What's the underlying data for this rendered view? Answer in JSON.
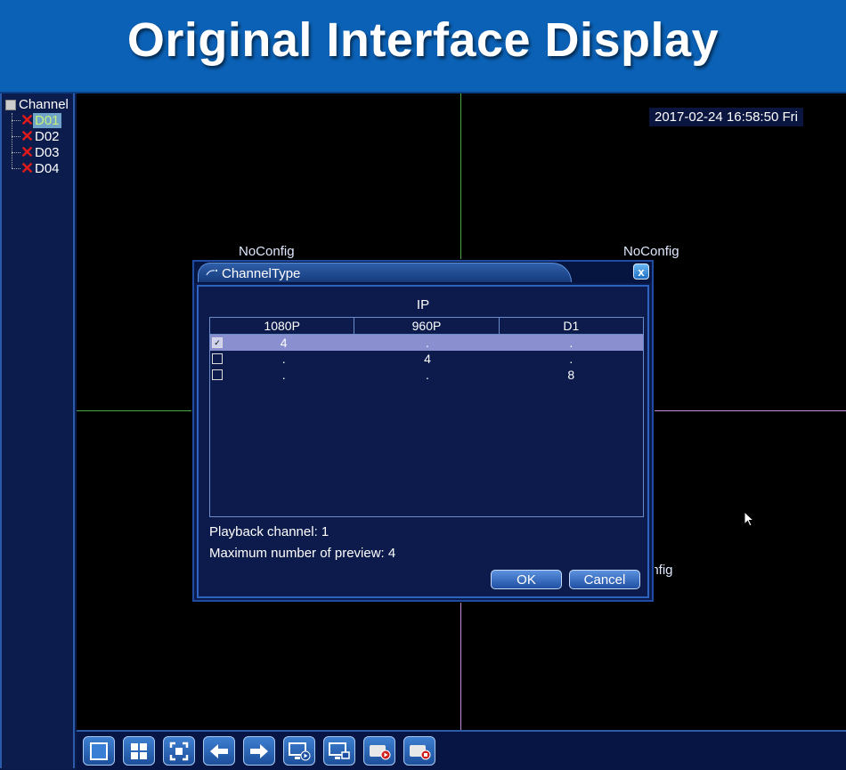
{
  "banner": {
    "title": "Original Interface Display"
  },
  "sidebar": {
    "root_label": "Channel",
    "items": [
      {
        "label": "D01",
        "selected": true
      },
      {
        "label": "D02",
        "selected": false
      },
      {
        "label": "D03",
        "selected": false
      },
      {
        "label": "D04",
        "selected": false
      }
    ]
  },
  "video": {
    "timestamp": "2017-02-24 16:58:50 Fri",
    "cells": [
      {
        "label": "NoConfig"
      },
      {
        "label": "NoConfig"
      },
      {
        "label": "onfig"
      }
    ]
  },
  "dialog": {
    "title": "ChannelType",
    "close_label": "x",
    "group_label": "IP",
    "columns": [
      "1080P",
      "960P",
      "D1"
    ],
    "rows": [
      {
        "checked": true,
        "checkmark": "✓",
        "cells": [
          "4",
          ".",
          "."
        ]
      },
      {
        "checked": false,
        "checkmark": "",
        "cells": [
          ".",
          "4",
          "."
        ]
      },
      {
        "checked": false,
        "checkmark": "",
        "cells": [
          ".",
          ".",
          "8"
        ]
      }
    ],
    "playback_channel": "Playback channel: 1",
    "max_preview": "Maximum number of preview: 4",
    "ok_label": "OK",
    "cancel_label": "Cancel"
  },
  "toolbar": {
    "buttons": [
      {
        "icon": "single-view-icon"
      },
      {
        "icon": "quad-view-icon"
      },
      {
        "icon": "fullscreen-icon"
      },
      {
        "icon": "previous-icon"
      },
      {
        "icon": "next-icon"
      },
      {
        "icon": "playback-icon"
      },
      {
        "icon": "switch-display-icon"
      },
      {
        "icon": "record-icon"
      },
      {
        "icon": "stop-record-icon"
      }
    ]
  },
  "colors": {
    "banner": "#0b61b5",
    "selected_row": "#8a8fd0",
    "grid_green": "#4aa84a",
    "grid_pink": "#c48bd3"
  }
}
